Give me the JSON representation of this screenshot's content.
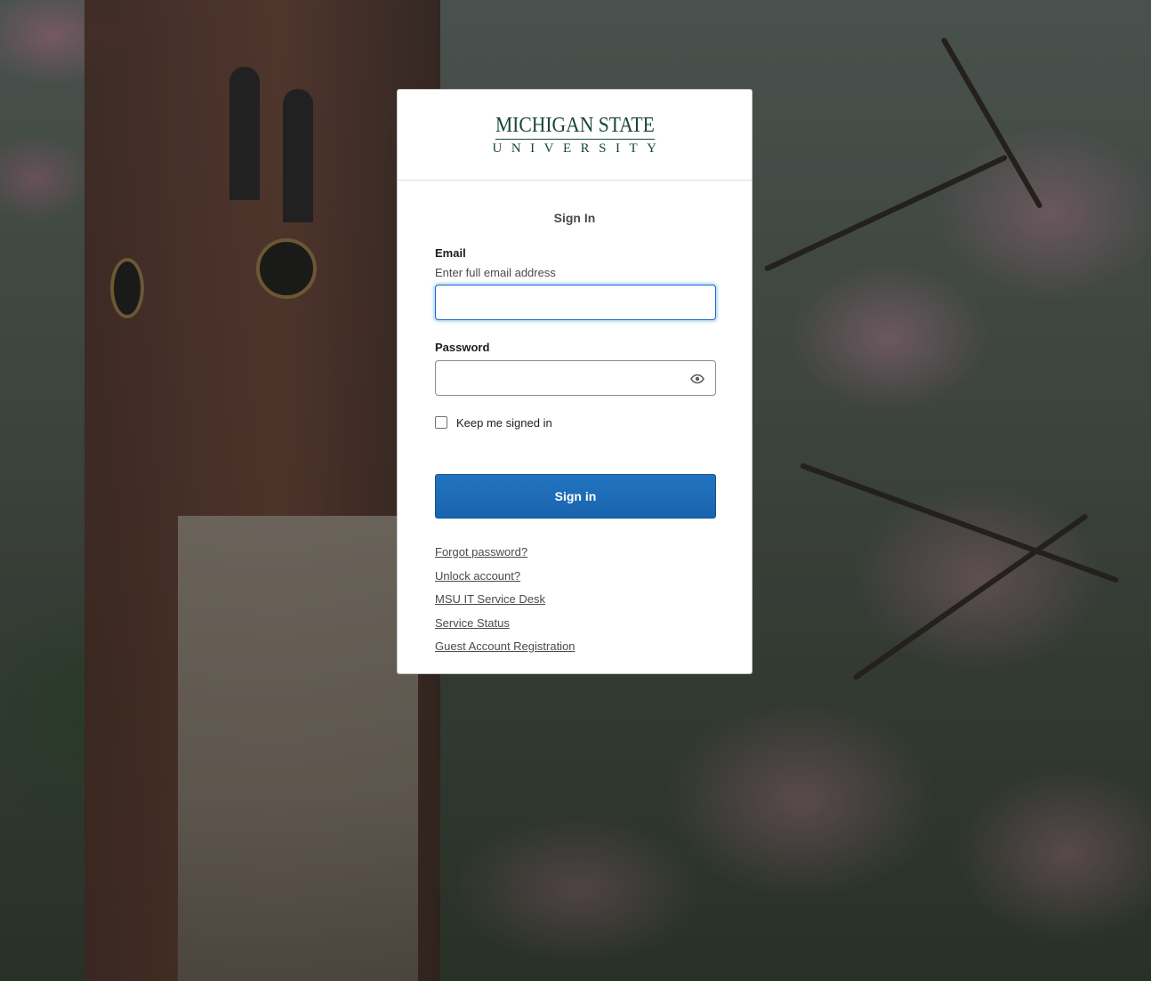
{
  "page": {
    "logo": {
      "line1": "MICHIGAN STATE",
      "line2": "UNIVERSITY"
    },
    "title": "Sign In",
    "email": {
      "label": "Email",
      "hint": "Enter full email address",
      "value": "",
      "placeholder": ""
    },
    "password": {
      "label": "Password",
      "value": "",
      "placeholder": "",
      "toggle_icon": "eye-icon"
    },
    "remember": {
      "label": "Keep me signed in",
      "checked": false
    },
    "submit_label": "Sign in",
    "links": [
      "Forgot password?",
      "Unlock account?",
      "MSU IT Service Desk",
      "Service Status",
      "Guest Account Registration"
    ]
  },
  "colors": {
    "brand_green": "#18453b",
    "button_blue": "#1f6db6",
    "focus_ring": "#1662dd"
  }
}
